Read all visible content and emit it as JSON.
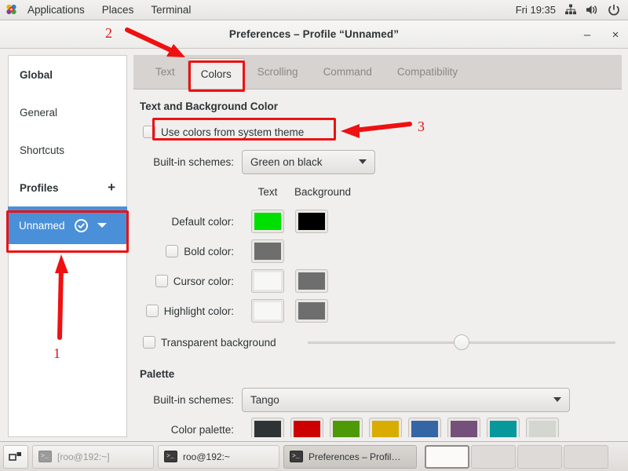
{
  "panel": {
    "logo_icon": "fedora-pinwheel-icon",
    "menus": [
      "Applications",
      "Places",
      "Terminal"
    ],
    "clock": "Fri 19:35",
    "tray": [
      "network-icon",
      "volume-icon",
      "power-icon"
    ]
  },
  "window": {
    "title": "Preferences – Profile “Unnamed”",
    "minimize_label": "–",
    "close_label": "×"
  },
  "sidebar": {
    "items": [
      {
        "label": "Global",
        "style": "heading",
        "selected": false
      },
      {
        "label": "General",
        "style": "normal",
        "selected": false
      },
      {
        "label": "Shortcuts",
        "style": "normal",
        "selected": false
      },
      {
        "label": "Profiles",
        "style": "heading",
        "selected": false,
        "action": "+"
      },
      {
        "label": "Unnamed",
        "style": "profile",
        "selected": true,
        "badge": "check-icon",
        "menu": "chevron-down-icon"
      }
    ]
  },
  "tabs": [
    {
      "label": "Text",
      "active": false
    },
    {
      "label": "Colors",
      "active": true
    },
    {
      "label": "Scrolling",
      "active": false
    },
    {
      "label": "Command",
      "active": false
    },
    {
      "label": "Compatibility",
      "active": false
    }
  ],
  "colors_tab": {
    "section1_title": "Text and Background Color",
    "use_system_theme": {
      "label": "Use colors from system theme",
      "checked": false
    },
    "builtin_schemes_label": "Built-in schemes:",
    "builtin_schemes_value": "Green on black",
    "column_text": "Text",
    "column_background": "Background",
    "rows": [
      {
        "label": "Default color:",
        "checkbox": false,
        "checked": false,
        "text_color": "#00e000",
        "bg_color": "#000000"
      },
      {
        "label": "Bold color:",
        "checkbox": true,
        "checked": false,
        "text_color": "#6e6e6e",
        "bg_color": null
      },
      {
        "label": "Cursor color:",
        "checkbox": true,
        "checked": false,
        "text_color": "#f7f7f5",
        "bg_color": "#6e6e6e"
      },
      {
        "label": "Highlight color:",
        "checkbox": true,
        "checked": false,
        "text_color": "#f7f7f5",
        "bg_color": "#6e6e6e"
      }
    ],
    "transparent_background": {
      "label": "Transparent background",
      "checked": false
    },
    "transparency_slider_percent": 50,
    "section2_title": "Palette",
    "palette_schemes_label": "Built-in schemes:",
    "palette_schemes_value": "Tango",
    "color_palette_label": "Color palette:",
    "palette_colors": [
      "#2e3436",
      "#cc0000",
      "#4e9a06",
      "#d8ad00",
      "#3465a4",
      "#75507b",
      "#06989a",
      "#d3d7cf"
    ]
  },
  "taskbar": {
    "show_desktop_icon": "show-desktop-icon",
    "tasks": [
      {
        "label": "[roo@192:~]",
        "state": "minimized"
      },
      {
        "label": "roo@192:~",
        "state": "normal"
      },
      {
        "label": "Preferences – Profil…",
        "state": "active"
      }
    ],
    "workspaces": [
      {
        "active": true
      },
      {
        "active": false
      },
      {
        "active": false
      },
      {
        "active": false
      }
    ]
  },
  "annotations": {
    "marks": [
      {
        "number": "1",
        "target": "sidebar-profile-unnamed"
      },
      {
        "number": "2",
        "target": "window-titlebar"
      },
      {
        "number": "3",
        "target": "use-colors-from-system-theme-checkbox"
      }
    ],
    "color": "#ee1111"
  }
}
